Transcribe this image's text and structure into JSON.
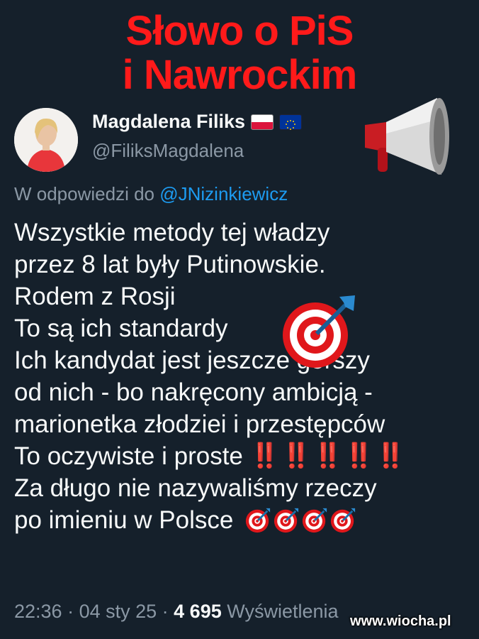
{
  "headline": {
    "line1": "Słowo o PiS",
    "line2": "i Nawrockim"
  },
  "author": {
    "name": "Magdalena Filiks",
    "handle": "@FiliksMagdalena",
    "flags": [
      "poland-flag-icon",
      "eu-flag-icon"
    ]
  },
  "reply": {
    "prefix": "W odpowiedzi do",
    "mention": "@JNizinkiewicz"
  },
  "tweet": {
    "lines": [
      "Wszystkie metody tej władzy",
      "przez 8 lat były Putinowskie.",
      "Rodem z Rosji",
      "To są ich standardy",
      "Ich kandydat jest jeszcze gorszy",
      "od nich - bo nakręcony ambicją -",
      "marionetka złodziei i przestępców",
      "To oczywiste i proste",
      "Za długo nie nazywaliśmy rzeczy",
      "po imieniu w Polsce"
    ],
    "bangs": "‼️‼️‼️‼️‼️"
  },
  "meta": {
    "time": "22:36",
    "sep1": " · ",
    "date": "04 sty 25",
    "sep2": " · ",
    "views": "4 695",
    "views_label": " Wyświetlenia"
  },
  "watermark": "www.wiocha.pl",
  "colors": {
    "background": "#15202b",
    "headline": "#ff1a1a",
    "mention": "#1d9bf0",
    "muted": "#8b98a5"
  }
}
